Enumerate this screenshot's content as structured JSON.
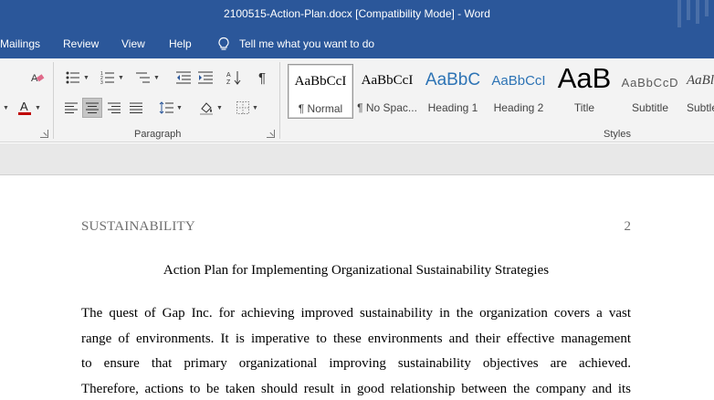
{
  "window": {
    "title": "2100515-Action-Plan.docx [Compatibility Mode]  -  Word",
    "title_bar_color": "#2b579a"
  },
  "menu": {
    "tabs": [
      "Mailings",
      "Review",
      "View",
      "Help"
    ],
    "tell_me": "Tell me what you want to do",
    "tell_me_icon": "lightbulb-icon"
  },
  "ribbon": {
    "paragraph_label": "Paragraph",
    "styles_label": "Styles",
    "font_color": "#c00000",
    "icons": [
      "clear-formatting-icon",
      "font-color-icon",
      "bullets-icon",
      "numbering-icon",
      "multilevel-list-icon",
      "decrease-indent-icon",
      "increase-indent-icon",
      "sort-icon",
      "show-paragraph-marks-icon",
      "align-left-icon",
      "align-center-icon",
      "align-right-icon",
      "justify-icon",
      "line-spacing-icon",
      "shading-icon",
      "borders-icon"
    ],
    "styles": [
      {
        "sample": "AaBbCcI",
        "name": "¶ Normal",
        "selected": true
      },
      {
        "sample": "AaBbCcI",
        "name": "¶ No Spac..."
      },
      {
        "sample": "AaBbC",
        "name": "Heading 1",
        "color": "#2e74b5"
      },
      {
        "sample": "AaBbCcI",
        "name": "Heading 2",
        "color": "#2e74b5"
      },
      {
        "sample": "AaB",
        "name": "Title"
      },
      {
        "sample": "AaBbCcD",
        "name": "Subtitle",
        "color": "#5a5a5a"
      },
      {
        "sample": "AaBl",
        "name": "Subtle..."
      }
    ]
  },
  "document": {
    "header_left": "SUSTAINABILITY",
    "page_number": "2",
    "title": "Action Plan for Implementing Organizational Sustainability Strategies",
    "paragraph_lines": [
      "The quest of Gap Inc. for achieving improved sustainability in the organization covers a vast",
      "range of environments. It is imperative to these environments and their effective management",
      "to ensure that primary organizational improving sustainability objectives are achieved.",
      "Therefore, actions to be taken should result in good relationship between the company and its"
    ]
  }
}
